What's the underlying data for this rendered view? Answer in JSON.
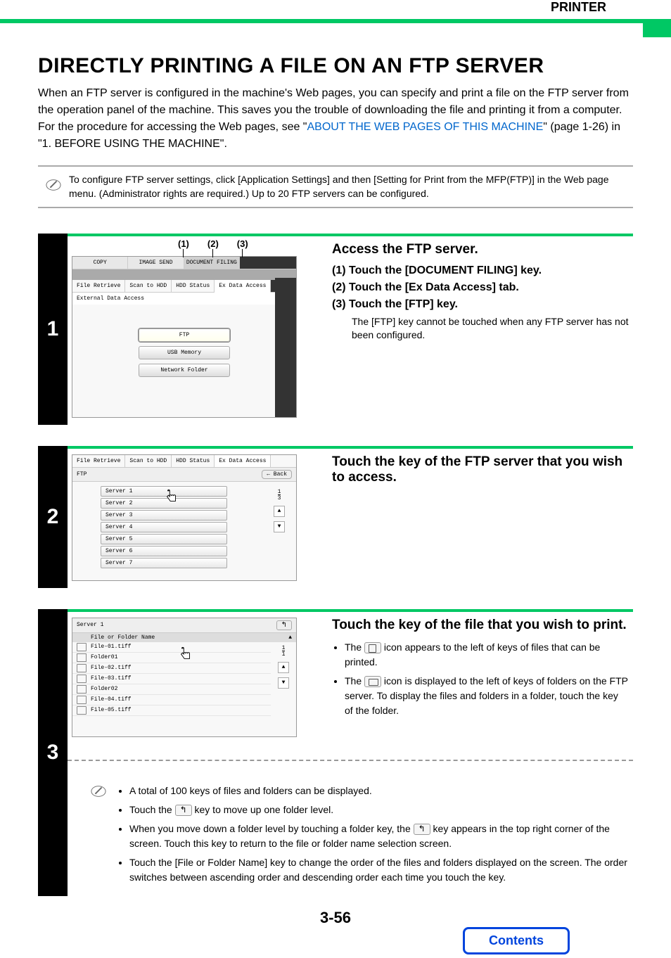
{
  "header": {
    "section": "PRINTER"
  },
  "title": "DIRECTLY PRINTING A FILE ON AN FTP SERVER",
  "intro": {
    "text1": "When an FTP server is configured in the machine's Web pages, you can specify and print a file on the FTP server from the operation panel of the machine. This saves you the trouble of downloading the file and printing it from a computer. For the procedure for accessing the Web pages, see \"",
    "link": "ABOUT THE WEB PAGES OF THIS MACHINE",
    "text2": "\" (page 1-26) in \"1. BEFORE USING THE MACHINE\"."
  },
  "note": "To configure FTP server settings, click [Application Settings] and then [Setting for Print from the MFP(FTP)] in the Web page menu. (Administrator rights are required.) Up to 20 FTP servers can be configured.",
  "step1": {
    "num": "1",
    "callouts": [
      "(1)",
      "(2)",
      "(3)"
    ],
    "title": "Access the FTP server.",
    "sub1": "(1)  Touch the [DOCUMENT FILING] key.",
    "sub2": "(2)  Touch the [Ex Data Access] tab.",
    "sub3": "(3)  Touch the [FTP] key.",
    "subnote": "The [FTP] key cannot be touched when any FTP server has not been configured.",
    "screen": {
      "topTabs": [
        "COPY",
        "IMAGE SEND",
        "DOCUMENT FILING"
      ],
      "tabs2": [
        "File Retrieve",
        "Scan to HDD",
        "HDD Status",
        "Ex Data Access"
      ],
      "panelTitle": "External Data Access",
      "btns": [
        "FTP",
        "USB Memory",
        "Network Folder"
      ]
    }
  },
  "step2": {
    "num": "2",
    "title": "Touch the key of the FTP server that you wish to access.",
    "screen": {
      "tabs2": [
        "File Retrieve",
        "Scan to HDD",
        "HDD Status",
        "Ex Data Access"
      ],
      "panelLabel": "FTP",
      "back": "Back",
      "servers": [
        "Server 1",
        "Server 2",
        "Server 3",
        "Server 4",
        "Server 5",
        "Server 6",
        "Server 7"
      ],
      "page": "1",
      "pages": "3"
    }
  },
  "step3": {
    "num": "3",
    "title": "Touch the key of the file that you wish to print.",
    "bullet1a": "The ",
    "bullet1b": " icon appears to the left of keys of files that can be printed.",
    "bullet2a": "The ",
    "bullet2b": " icon is displayed to the left of keys of folders on the FTP server. To display the files and folders in a folder, touch the key of the folder.",
    "screen": {
      "serverName": "Server 1",
      "colHead": "File or Folder Name",
      "rows": [
        {
          "icon": "file",
          "name": "File-01.tiff"
        },
        {
          "icon": "folder",
          "name": "Folder01"
        },
        {
          "icon": "file",
          "name": "File-02.tiff"
        },
        {
          "icon": "file",
          "name": "File-03.tiff"
        },
        {
          "icon": "folder",
          "name": "Folder02"
        },
        {
          "icon": "file",
          "name": "File-04.tiff"
        },
        {
          "icon": "file",
          "name": "File-05.tiff"
        }
      ],
      "page": "1",
      "pages": "1"
    },
    "notes": [
      "A total of 100 keys of files and folders can be displayed.",
      "Touch the [UP] key to move up one folder level.",
      "When you move down a folder level by touching a folder key, the [UP] key appears in the top right corner of the screen. Touch this key to return to the file or folder name selection screen.",
      "Touch the [File or Folder Name] key to change the order of the files and folders displayed on the screen. The order switches between ascending order and descending order each time you touch the key."
    ],
    "note_prefix_1": "Touch the ",
    "note_suffix_1": " key to move up one folder level.",
    "note_prefix_2": "When you move down a folder level by touching a folder key, the ",
    "note_suffix_2": " key appears in the top right corner of the screen. Touch this key to return to the file or folder name selection screen."
  },
  "pageNum": "3-56",
  "contents": "Contents"
}
